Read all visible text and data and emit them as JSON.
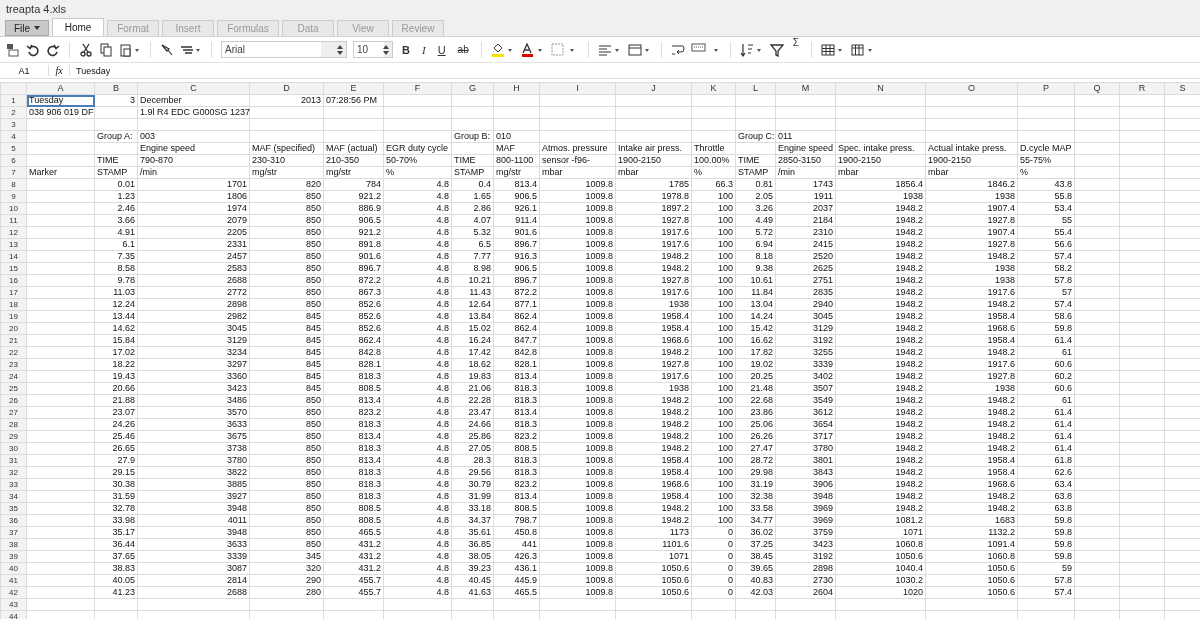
{
  "window": {
    "title": "treapta 4.xls"
  },
  "file_menu": {
    "label": "File"
  },
  "tabs": [
    {
      "label": "Home",
      "selected": true
    },
    {
      "label": "Format",
      "selected": false
    },
    {
      "label": "Insert",
      "selected": false
    },
    {
      "label": "Formulas",
      "selected": false
    },
    {
      "label": "Data",
      "selected": false
    },
    {
      "label": "View",
      "selected": false
    },
    {
      "label": "Review",
      "selected": false
    }
  ],
  "toolbar": {
    "font": "Arial",
    "size": "10",
    "bold": "B",
    "italic": "I",
    "underline": "U",
    "strike": "ab",
    "sum": "Σ"
  },
  "formula_bar": {
    "cell_ref": "A1",
    "fx": "fx",
    "value": "Tuesday"
  },
  "sheet": {
    "columns": [
      "A",
      "B",
      "C",
      "D",
      "E",
      "F",
      "G",
      "H",
      "I",
      "J",
      "K",
      "L",
      "M",
      "N",
      "O",
      "P",
      "Q",
      "R",
      "S"
    ],
    "rows": [
      {
        "number": "1",
        "cells": [
          {
            "text": "Tuesday",
            "selected": true
          },
          {
            "text": "3",
            "numeric": true
          },
          "December",
          {
            "text": "2013",
            "numeric": true
          },
          "07:28:56 PM"
        ]
      },
      {
        "number": "2",
        "cells": [
          "038 906 019 DF",
          null,
          "1.9l R4 EDC G000SG 1237"
        ]
      },
      {
        "number": "3"
      },
      {
        "number": "4",
        "cells": [
          null,
          "Group A:",
          "003",
          null,
          null,
          null,
          "Group B:",
          "010",
          null,
          null,
          null,
          "Group C:",
          "011"
        ]
      },
      {
        "number": "5",
        "cells": [
          null,
          null,
          "Engine speed",
          "MAF (specified)",
          "MAF (actual)",
          "EGR duty cycle",
          null,
          "MAF",
          "Atmos. pressure",
          "Intake air press.",
          "Throttle",
          null,
          "Engine speed",
          "Spec. intake press.",
          "Actual intake press.",
          "D.cycle MAP"
        ]
      },
      {
        "number": "6",
        "cells": [
          null,
          "TIME",
          "790-870",
          "230-310",
          "210-350",
          "50-70%",
          "TIME",
          "800-1100",
          "sensor -f96-",
          "1900-2150",
          "100.00%",
          "TIME",
          "2850-3150",
          "1900-2150",
          "1900-2150",
          "55-75%"
        ]
      },
      {
        "number": "7",
        "cells": [
          "Marker",
          "STAMP",
          "/min",
          "mg/str",
          "mg/str",
          "%",
          "STAMP",
          "mg/str",
          "mbar",
          "mbar",
          "%",
          "STAMP",
          "/min",
          "mbar",
          "mbar",
          "%"
        ]
      },
      {
        "number": "8",
        "kind": "data",
        "cells": [
          null,
          "0.01",
          "1701",
          "820",
          "784",
          "4.8",
          "0.4",
          "813.4",
          "1009.8",
          "1785",
          "66.3",
          "0.81",
          "1743",
          "1856.4",
          "1846.2",
          "43.8"
        ]
      },
      {
        "number": "9",
        "kind": "data",
        "cells": [
          null,
          "1.23",
          "1806",
          "850",
          "921.2",
          "4.8",
          "1.65",
          "906.5",
          "1009.8",
          "1978.8",
          "100",
          "2.05",
          "1911",
          "1938",
          "1938",
          "55.8"
        ]
      },
      {
        "number": "10",
        "kind": "data",
        "cells": [
          null,
          "2.46",
          "1974",
          "850",
          "886.9",
          "4.8",
          "2.86",
          "926.1",
          "1009.8",
          "1897.2",
          "100",
          "3.26",
          "2037",
          "1948.2",
          "1907.4",
          "53.4"
        ]
      },
      {
        "number": "11",
        "kind": "data",
        "cells": [
          null,
          "3.66",
          "2079",
          "850",
          "906.5",
          "4.8",
          "4.07",
          "911.4",
          "1009.8",
          "1927.8",
          "100",
          "4.49",
          "2184",
          "1948.2",
          "1927.8",
          "55"
        ]
      },
      {
        "number": "12",
        "kind": "data",
        "cells": [
          null,
          "4.91",
          "2205",
          "850",
          "921.2",
          "4.8",
          "5.32",
          "901.6",
          "1009.8",
          "1917.6",
          "100",
          "5.72",
          "2310",
          "1948.2",
          "1907.4",
          "55.4"
        ]
      },
      {
        "number": "13",
        "kind": "data",
        "cells": [
          null,
          "6.1",
          "2331",
          "850",
          "891.8",
          "4.8",
          "6.5",
          "896.7",
          "1009.8",
          "1917.6",
          "100",
          "6.94",
          "2415",
          "1948.2",
          "1927.8",
          "56.6"
        ]
      },
      {
        "number": "14",
        "kind": "data",
        "cells": [
          null,
          "7.35",
          "2457",
          "850",
          "901.6",
          "4.8",
          "7.77",
          "916.3",
          "1009.8",
          "1948.2",
          "100",
          "8.18",
          "2520",
          "1948.2",
          "1948.2",
          "57.4"
        ]
      },
      {
        "number": "15",
        "kind": "data",
        "cells": [
          null,
          "8.58",
          "2583",
          "850",
          "896.7",
          "4.8",
          "8.98",
          "906.5",
          "1009.8",
          "1948.2",
          "100",
          "9.38",
          "2625",
          "1948.2",
          "1938",
          "58.2"
        ]
      },
      {
        "number": "16",
        "kind": "data",
        "cells": [
          null,
          "9.78",
          "2688",
          "850",
          "872.2",
          "4.8",
          "10.21",
          "896.7",
          "1009.8",
          "1927.8",
          "100",
          "10.61",
          "2751",
          "1948.2",
          "1938",
          "57.8"
        ]
      },
      {
        "number": "17",
        "kind": "data",
        "cells": [
          null,
          "11.03",
          "2772",
          "850",
          "867.3",
          "4.8",
          "11.43",
          "872.2",
          "1009.8",
          "1917.6",
          "100",
          "11.84",
          "2835",
          "1948.2",
          "1917.6",
          "57"
        ]
      },
      {
        "number": "18",
        "kind": "data",
        "cells": [
          null,
          "12.24",
          "2898",
          "850",
          "852.6",
          "4.8",
          "12.64",
          "877.1",
          "1009.8",
          "1938",
          "100",
          "13.04",
          "2940",
          "1948.2",
          "1948.2",
          "57.4"
        ]
      },
      {
        "number": "19",
        "kind": "data",
        "cells": [
          null,
          "13.44",
          "2982",
          "845",
          "852.6",
          "4.8",
          "13.84",
          "862.4",
          "1009.8",
          "1958.4",
          "100",
          "14.24",
          "3045",
          "1948.2",
          "1958.4",
          "58.6"
        ]
      },
      {
        "number": "20",
        "kind": "data",
        "cells": [
          null,
          "14.62",
          "3045",
          "845",
          "852.6",
          "4.8",
          "15.02",
          "862.4",
          "1009.8",
          "1958.4",
          "100",
          "15.42",
          "3129",
          "1948.2",
          "1968.6",
          "59.8"
        ]
      },
      {
        "number": "21",
        "kind": "data",
        "cells": [
          null,
          "15.84",
          "3129",
          "845",
          "862.4",
          "4.8",
          "16.24",
          "847.7",
          "1009.8",
          "1968.6",
          "100",
          "16.62",
          "3192",
          "1948.2",
          "1958.4",
          "61.4"
        ]
      },
      {
        "number": "22",
        "kind": "data",
        "cells": [
          null,
          "17.02",
          "3234",
          "845",
          "842.8",
          "4.8",
          "17.42",
          "842.8",
          "1009.8",
          "1948.2",
          "100",
          "17.82",
          "3255",
          "1948.2",
          "1948.2",
          "61"
        ]
      },
      {
        "number": "23",
        "kind": "data",
        "cells": [
          null,
          "18.22",
          "3297",
          "845",
          "828.1",
          "4.8",
          "18.62",
          "828.1",
          "1009.8",
          "1927.8",
          "100",
          "19.02",
          "3339",
          "1948.2",
          "1917.6",
          "60.6"
        ]
      },
      {
        "number": "24",
        "kind": "data",
        "cells": [
          null,
          "19.43",
          "3360",
          "845",
          "818.3",
          "4.8",
          "19.83",
          "813.4",
          "1009.8",
          "1917.6",
          "100",
          "20.25",
          "3402",
          "1948.2",
          "1927.8",
          "60.2"
        ]
      },
      {
        "number": "25",
        "kind": "data",
        "cells": [
          null,
          "20.66",
          "3423",
          "845",
          "808.5",
          "4.8",
          "21.06",
          "818.3",
          "1009.8",
          "1938",
          "100",
          "21.48",
          "3507",
          "1948.2",
          "1938",
          "60.6"
        ]
      },
      {
        "number": "26",
        "kind": "data",
        "cells": [
          null,
          "21.88",
          "3486",
          "850",
          "813.4",
          "4.8",
          "22.28",
          "818.3",
          "1009.8",
          "1948.2",
          "100",
          "22.68",
          "3549",
          "1948.2",
          "1948.2",
          "61"
        ]
      },
      {
        "number": "27",
        "kind": "data",
        "cells": [
          null,
          "23.07",
          "3570",
          "850",
          "823.2",
          "4.8",
          "23.47",
          "813.4",
          "1009.8",
          "1948.2",
          "100",
          "23.86",
          "3612",
          "1948.2",
          "1948.2",
          "61.4"
        ]
      },
      {
        "number": "28",
        "kind": "data",
        "cells": [
          null,
          "24.26",
          "3633",
          "850",
          "818.3",
          "4.8",
          "24.66",
          "818.3",
          "1009.8",
          "1948.2",
          "100",
          "25.06",
          "3654",
          "1948.2",
          "1948.2",
          "61.4"
        ]
      },
      {
        "number": "29",
        "kind": "data",
        "cells": [
          null,
          "25.46",
          "3675",
          "850",
          "813.4",
          "4.8",
          "25.86",
          "823.2",
          "1009.8",
          "1948.2",
          "100",
          "26.26",
          "3717",
          "1948.2",
          "1948.2",
          "61.4"
        ]
      },
      {
        "number": "30",
        "kind": "data",
        "cells": [
          null,
          "26.65",
          "3738",
          "850",
          "818.3",
          "4.8",
          "27.05",
          "808.5",
          "1009.8",
          "1948.2",
          "100",
          "27.47",
          "3780",
          "1948.2",
          "1948.2",
          "61.4"
        ]
      },
      {
        "number": "31",
        "kind": "data",
        "cells": [
          null,
          "27.9",
          "3780",
          "850",
          "813.4",
          "4.8",
          "28.3",
          "818.3",
          "1009.8",
          "1958.4",
          "100",
          "28.72",
          "3801",
          "1948.2",
          "1958.4",
          "61.8"
        ]
      },
      {
        "number": "32",
        "kind": "data",
        "cells": [
          null,
          "29.15",
          "3822",
          "850",
          "818.3",
          "4.8",
          "29.56",
          "818.3",
          "1009.8",
          "1958.4",
          "100",
          "29.98",
          "3843",
          "1948.2",
          "1958.4",
          "62.6"
        ]
      },
      {
        "number": "33",
        "kind": "data",
        "cells": [
          null,
          "30.38",
          "3885",
          "850",
          "818.3",
          "4.8",
          "30.79",
          "823.2",
          "1009.8",
          "1968.6",
          "100",
          "31.19",
          "3906",
          "1948.2",
          "1968.6",
          "63.4"
        ]
      },
      {
        "number": "34",
        "kind": "data",
        "cells": [
          null,
          "31.59",
          "3927",
          "850",
          "818.3",
          "4.8",
          "31.99",
          "813.4",
          "1009.8",
          "1958.4",
          "100",
          "32.38",
          "3948",
          "1948.2",
          "1948.2",
          "63.8"
        ]
      },
      {
        "number": "35",
        "kind": "data",
        "cells": [
          null,
          "32.78",
          "3948",
          "850",
          "808.5",
          "4.8",
          "33.18",
          "808.5",
          "1009.8",
          "1948.2",
          "100",
          "33.58",
          "3969",
          "1948.2",
          "1948.2",
          "63.8"
        ]
      },
      {
        "number": "36",
        "kind": "data",
        "cells": [
          null,
          "33.98",
          "4011",
          "850",
          "808.5",
          "4.8",
          "34.37",
          "798.7",
          "1009.8",
          "1948.2",
          "100",
          "34.77",
          "3969",
          "1081.2",
          "1683",
          "59.8"
        ]
      },
      {
        "number": "37",
        "kind": "data",
        "cells": [
          null,
          "35.17",
          "3948",
          "850",
          "465.5",
          "4.8",
          "35.61",
          "450.8",
          "1009.8",
          "1173",
          "0",
          "36.02",
          "3759",
          "1071",
          "1132.2",
          "59.8"
        ]
      },
      {
        "number": "38",
        "kind": "data",
        "cells": [
          null,
          "36.44",
          "3633",
          "850",
          "431.2",
          "4.8",
          "36.85",
          "441",
          "1009.8",
          "1101.6",
          "0",
          "37.25",
          "3423",
          "1060.8",
          "1091.4",
          "59.8"
        ]
      },
      {
        "number": "39",
        "kind": "data",
        "cells": [
          null,
          "37.65",
          "3339",
          "345",
          "431.2",
          "4.8",
          "38.05",
          "426.3",
          "1009.8",
          "1071",
          "0",
          "38.45",
          "3192",
          "1050.6",
          "1060.8",
          "59.8"
        ]
      },
      {
        "number": "40",
        "kind": "data",
        "cells": [
          null,
          "38.83",
          "3087",
          "320",
          "431.2",
          "4.8",
          "39.23",
          "436.1",
          "1009.8",
          "1050.6",
          "0",
          "39.65",
          "2898",
          "1040.4",
          "1050.6",
          "59"
        ]
      },
      {
        "number": "41",
        "kind": "data",
        "cells": [
          null,
          "40.05",
          "2814",
          "290",
          "455.7",
          "4.8",
          "40.45",
          "445.9",
          "1009.8",
          "1050.6",
          "0",
          "40.83",
          "2730",
          "1030.2",
          "1050.6",
          "57.8"
        ]
      },
      {
        "number": "42",
        "kind": "data",
        "cells": [
          null,
          "41.23",
          "2688",
          "280",
          "455.7",
          "4.8",
          "41.63",
          "465.5",
          "1009.8",
          "1050.6",
          "0",
          "42.03",
          "2604",
          "1020",
          "1050.6",
          "57.4"
        ]
      },
      {
        "number": "43"
      },
      {
        "number": "44"
      }
    ]
  }
}
